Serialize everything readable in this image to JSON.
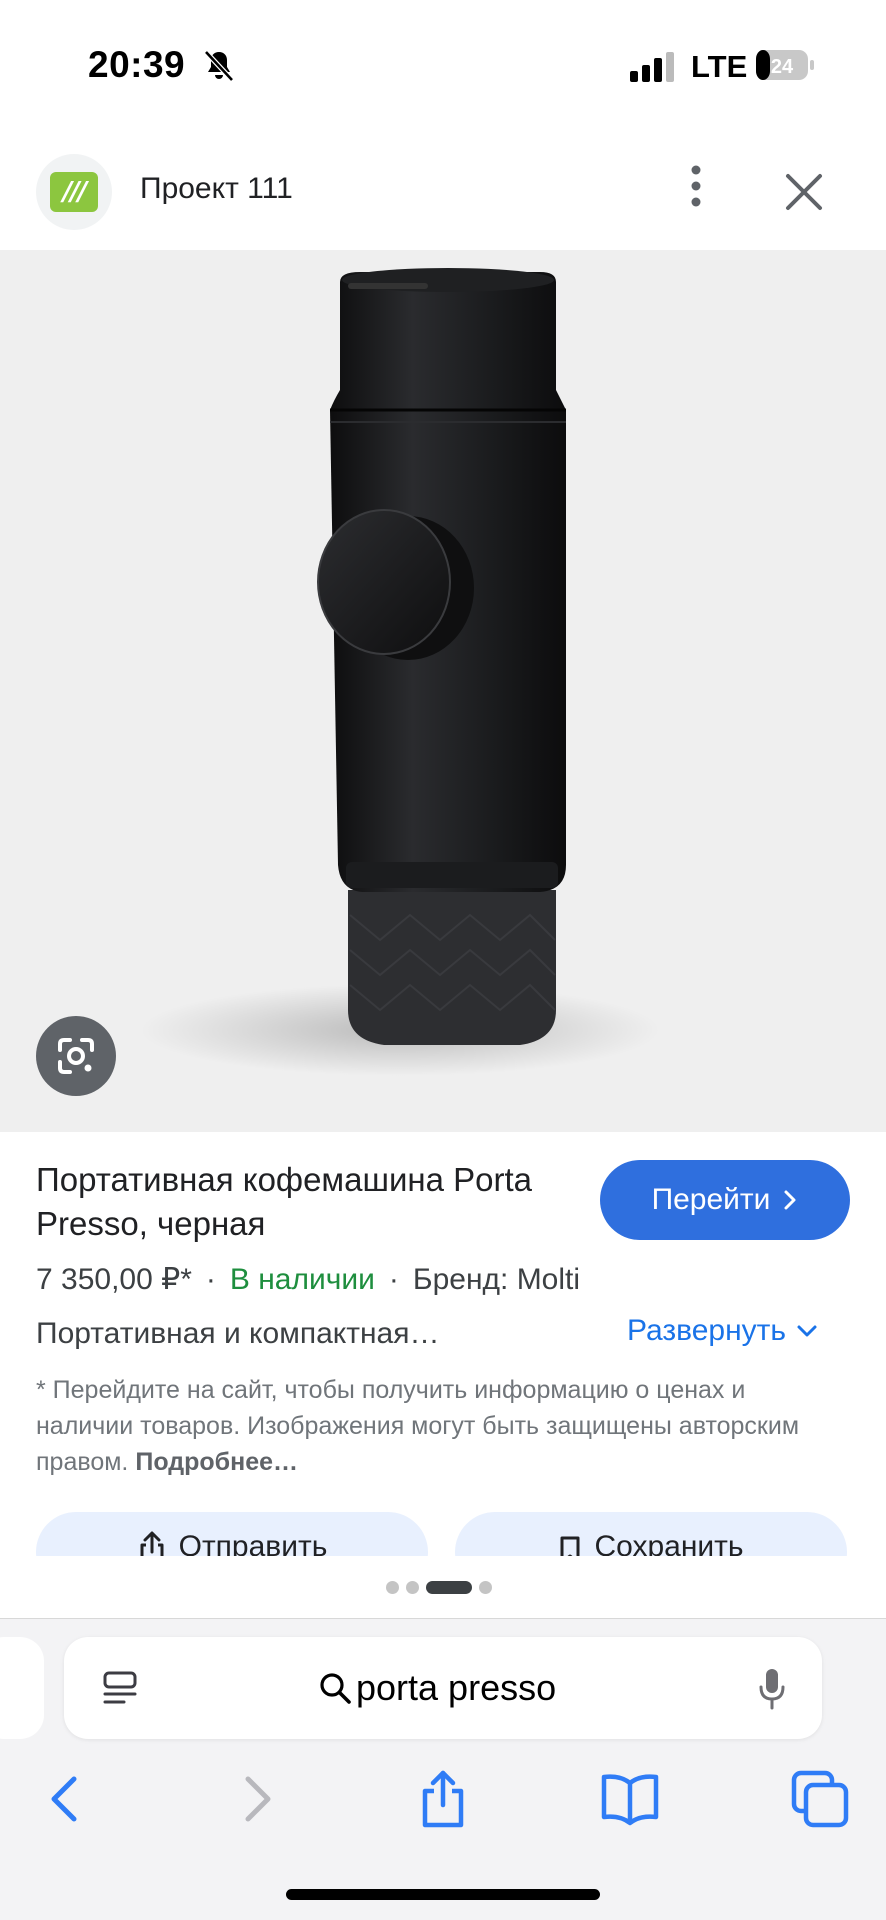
{
  "status": {
    "time": "20:39",
    "network": "LTE",
    "battery": "24"
  },
  "site": {
    "logo_text": "///",
    "name": "Проект 111"
  },
  "product": {
    "title": "Портативная кофемашина Porta Presso, черная",
    "visit_label": "Перейти",
    "price": "7 350,00 ₽*",
    "stock": "В наличии",
    "brand": "Бренд: Molti",
    "description": "Портативная и компактная…",
    "expand_label": "Развернуть",
    "disclaimer": "* Перейдите на сайт, чтобы получить информацию о ценах и наличии товаров. Изображения могут быть защищены авторским правом.",
    "disclaimer_more": "Подробнее…",
    "send_label": "Отправить",
    "save_label": "Сохранить"
  },
  "carousel": {
    "count": 4,
    "active": 2
  },
  "browser": {
    "query": "porta presso"
  },
  "colors": {
    "accent": "#2f6fde",
    "in_stock": "#1e8e3e",
    "link": "#1a73e8",
    "ios_blue": "#2f7cf6"
  },
  "icons": [
    "bell-off-icon",
    "signal-icon",
    "battery-icon",
    "more-vert-icon",
    "close-icon",
    "google-lens-icon",
    "chevron-right-icon",
    "chevron-down-icon",
    "share-icon",
    "bookmark-icon",
    "reader-icon",
    "search-icon",
    "mic-icon",
    "back-icon",
    "forward-icon",
    "safari-share-icon",
    "bookmarks-icon",
    "tabs-icon"
  ]
}
